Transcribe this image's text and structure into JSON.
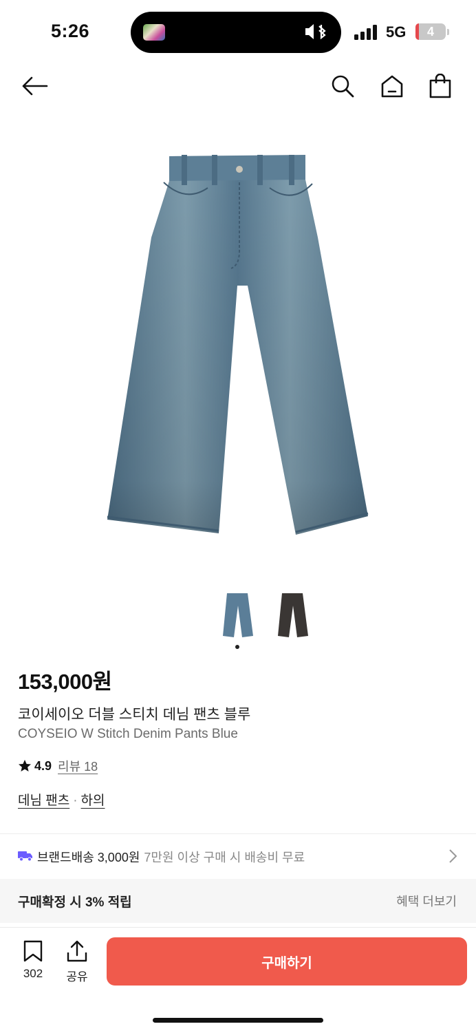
{
  "status_bar": {
    "time": "5:26",
    "network": "5G",
    "battery": "4"
  },
  "nav": {
    "back_icon": "arrow-left-icon",
    "search_icon": "search-icon",
    "home_icon": "home-icon",
    "cart_icon": "shopping-bag-icon"
  },
  "product": {
    "price": "153,000원",
    "name_ko": "코이세이오 더블 스티치 데님 팬츠 블루",
    "name_en": "COYSEIO W Stitch Denim Pants Blue",
    "rating": "4.9",
    "reviews": "리뷰 18",
    "category_1": "데님 팬츠",
    "category_sep": "·",
    "category_2": "하의",
    "thumbnail_count": 2,
    "selected_thumbnail": 1,
    "colors": {
      "denim": "#5b7e98",
      "black": "#3a3634"
    }
  },
  "shipping": {
    "label": "브랜드배송 3,000원",
    "note": "7만원 이상 구매 시 배송비 무료",
    "icon": "truck-icon",
    "truck_color": "#6b5cff"
  },
  "benefit": {
    "title": "구매확정 시 3% 적립",
    "more": "혜택 더보기"
  },
  "bottom_bar": {
    "bookmark_count": "302",
    "share_label": "공유",
    "buy_label": "구매하기",
    "accent": "#f05a4c"
  }
}
